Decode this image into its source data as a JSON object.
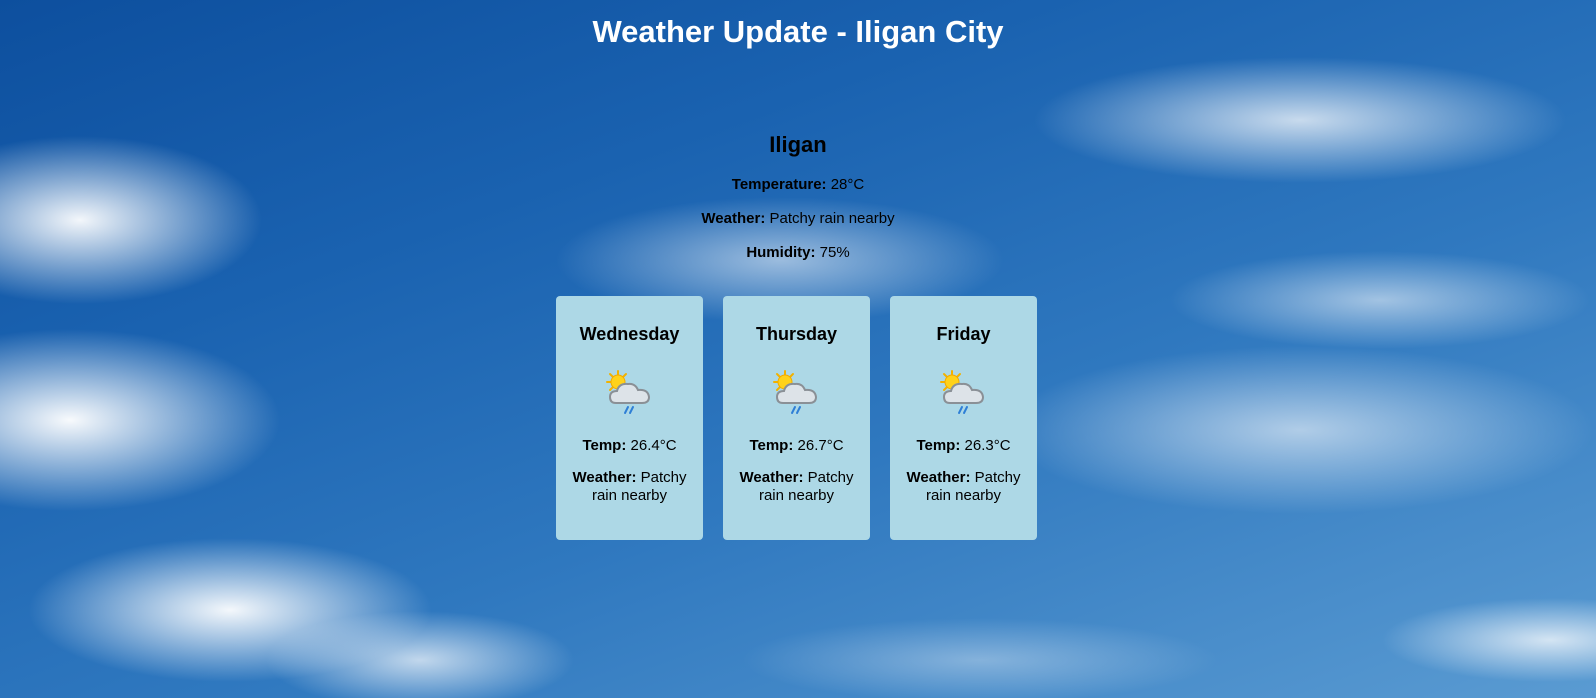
{
  "header": {
    "title": "Weather Update - Iligan City"
  },
  "current": {
    "city": "Iligan",
    "temperature_label": "Temperature:",
    "temperature_value": "28°C",
    "weather_label": "Weather:",
    "weather_value": "Patchy rain nearby",
    "humidity_label": "Humidity:",
    "humidity_value": "75%"
  },
  "forecast": [
    {
      "day": "Wednesday",
      "icon": "patchy-rain-icon",
      "temp_label": "Temp:",
      "temp_value": "26.4°C",
      "weather_label": "Weather:",
      "weather_value": "Patchy rain nearby"
    },
    {
      "day": "Thursday",
      "icon": "patchy-rain-icon",
      "temp_label": "Temp:",
      "temp_value": "26.7°C",
      "weather_label": "Weather:",
      "weather_value": "Patchy rain nearby"
    },
    {
      "day": "Friday",
      "icon": "patchy-rain-icon",
      "temp_label": "Temp:",
      "temp_value": "26.3°C",
      "weather_label": "Weather:",
      "weather_value": "Patchy rain nearby"
    }
  ],
  "colors": {
    "card_background": "#add8e6",
    "title_text": "#ffffff"
  }
}
